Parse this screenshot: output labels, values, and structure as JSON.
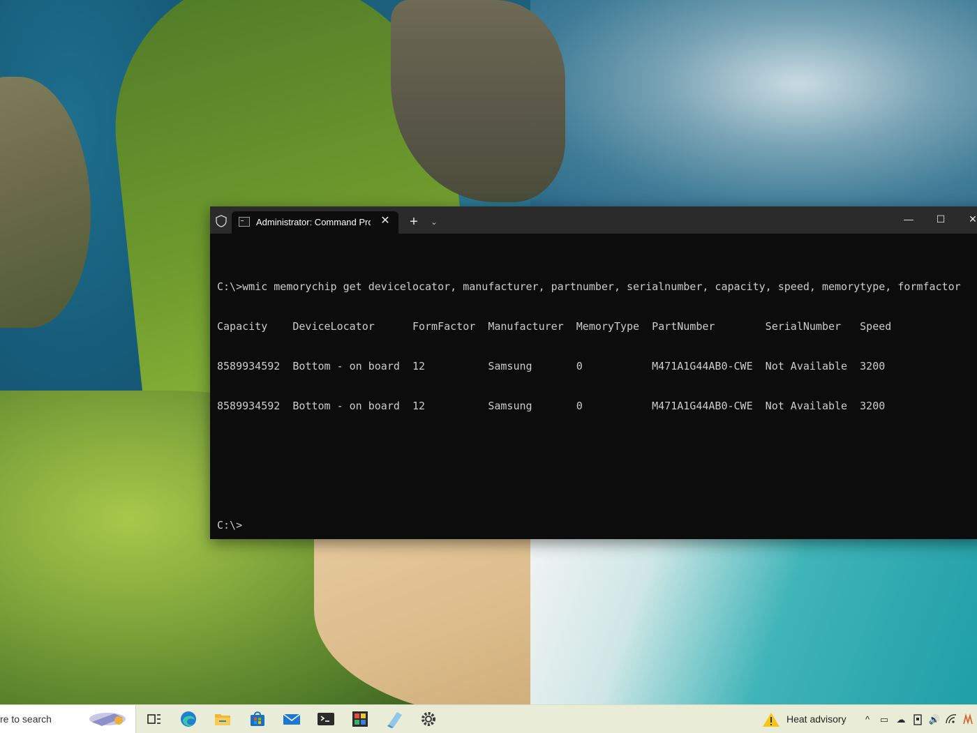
{
  "terminal": {
    "tab_title": "Administrator: Command Prompt",
    "tab_close": "✕",
    "new_tab": "+",
    "dropdown": "⌄",
    "minimize": "—",
    "maximize": "☐",
    "close": "✕",
    "lines": [
      "C:\\>wmic memorychip get devicelocator, manufacturer, partnumber, serialnumber, capacity, speed, memorytype, formfactor",
      "Capacity    DeviceLocator      FormFactor  Manufacturer  MemoryType  PartNumber        SerialNumber   Speed",
      "8589934592  Bottom - on board  12          Samsung       0           M471A1G44AB0-CWE  Not Available  3200",
      "8589934592  Bottom - on board  12          Samsung       0           M471A1G44AB0-CWE  Not Available  3200",
      "",
      "",
      "C:\\>"
    ]
  },
  "taskbar": {
    "search_text": "re to search",
    "apps": [
      {
        "name": "task-view-icon"
      },
      {
        "name": "edge-icon"
      },
      {
        "name": "file-explorer-icon"
      },
      {
        "name": "store-icon"
      },
      {
        "name": "mail-icon"
      },
      {
        "name": "terminal-icon"
      },
      {
        "name": "app-icon"
      },
      {
        "name": "notepad-icon"
      },
      {
        "name": "settings-icon"
      }
    ],
    "weather_text": "Heat advisory",
    "tray": {
      "chevron": "^",
      "battery": "▭",
      "onedrive": "☁",
      "volume": "🔊",
      "wifi": "◠"
    }
  }
}
